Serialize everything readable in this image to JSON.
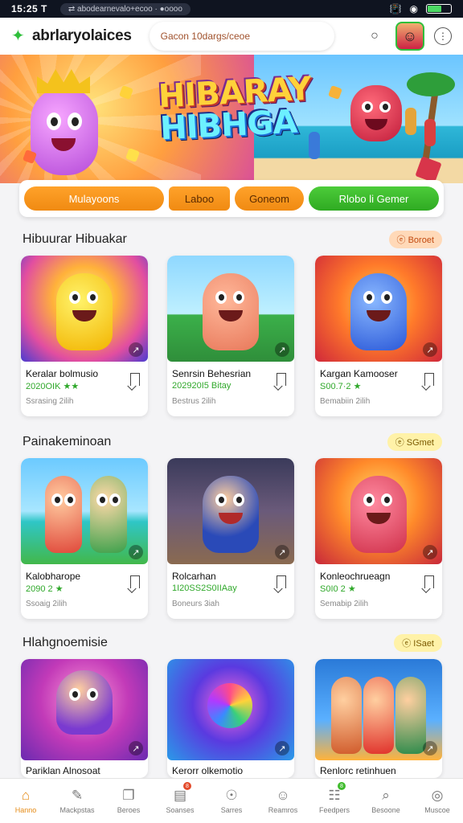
{
  "status_bar": {
    "time": "15:25 T",
    "url": "⇄ abodearnevalo+ecoo · ●oooo"
  },
  "header": {
    "brand": "abrlaryolaices",
    "search_text": "Gacon 10dargs/ceoe",
    "icons": [
      "notification-bell-icon",
      "profile-avatar",
      "settings-icon"
    ]
  },
  "hero": {
    "title_line1": "HIBARAY",
    "title_line2": "HIBHGA"
  },
  "filters": [
    {
      "label": "Mulayoons",
      "color": "#f39a1c"
    },
    {
      "label": "Laboo",
      "color": "#f39a1c"
    },
    {
      "label": "Goneom",
      "color": "#f39a1c"
    },
    {
      "label": "Rlobo li Gemer",
      "color": "#3fbb2c"
    }
  ],
  "sections": [
    {
      "title": "Hibuurar Hibuakar",
      "badge": "ⓔ Boroet",
      "cards": [
        {
          "name": "Keralar bolmusio",
          "rating": "2020OIK ★★",
          "meta": "Ssrasing 2ilih"
        },
        {
          "name": "Senrsin Behesrian",
          "rating": "202920I5 Bitay",
          "meta": "Bestrus 2ilih"
        },
        {
          "name": "Kargan Kamooser",
          "rating": "S00.7·2 ★",
          "meta": "Bemabiin 2ilih"
        }
      ]
    },
    {
      "title": "Painakeminoan",
      "badge": "ⓔ SGmet",
      "cards": [
        {
          "name": "Kalobharope",
          "rating": "2090 2 ★",
          "meta": "Ssoaig 2ilih"
        },
        {
          "name": "Rolcarhan",
          "rating": "1I20SS2S0IIAay",
          "meta": "Boneurs 3iah"
        },
        {
          "name": "Konleochrueagn",
          "rating": "S0I0 2 ★",
          "meta": "Semabip 2ilih"
        }
      ]
    },
    {
      "title": "Hlahgnoemisie",
      "badge": "ⓔ ISaet",
      "cards": [
        {
          "name": "Pariklan Alnosoat",
          "rating": "",
          "meta": ""
        },
        {
          "name": "Kerorr olkemotio",
          "rating": "",
          "meta": ""
        },
        {
          "name": "Renlorc retinhuen",
          "rating": "",
          "meta": ""
        }
      ]
    }
  ],
  "bottom_nav": [
    {
      "label": "Hanno",
      "icon": "home-icon",
      "active": true
    },
    {
      "label": "Mackpstas",
      "icon": "pen-icon",
      "active": false
    },
    {
      "label": "Beroes",
      "icon": "bookmark-icon",
      "active": false
    },
    {
      "label": "Soanses",
      "icon": "inbox-icon",
      "active": false,
      "badge": "8"
    },
    {
      "label": "Sarres",
      "icon": "compass-icon",
      "active": false
    },
    {
      "label": "Reamros",
      "icon": "user-icon",
      "active": false
    },
    {
      "label": "Feedpers",
      "icon": "feed-icon",
      "active": false,
      "badge": "8"
    },
    {
      "label": "Besoone",
      "icon": "search-icon",
      "active": false
    },
    {
      "label": "Muscoe",
      "icon": "gamepad-icon",
      "active": false
    }
  ],
  "colors": {
    "accent_orange": "#f39a1c",
    "accent_green": "#3fbb2c",
    "active_nav": "#e58b16"
  }
}
